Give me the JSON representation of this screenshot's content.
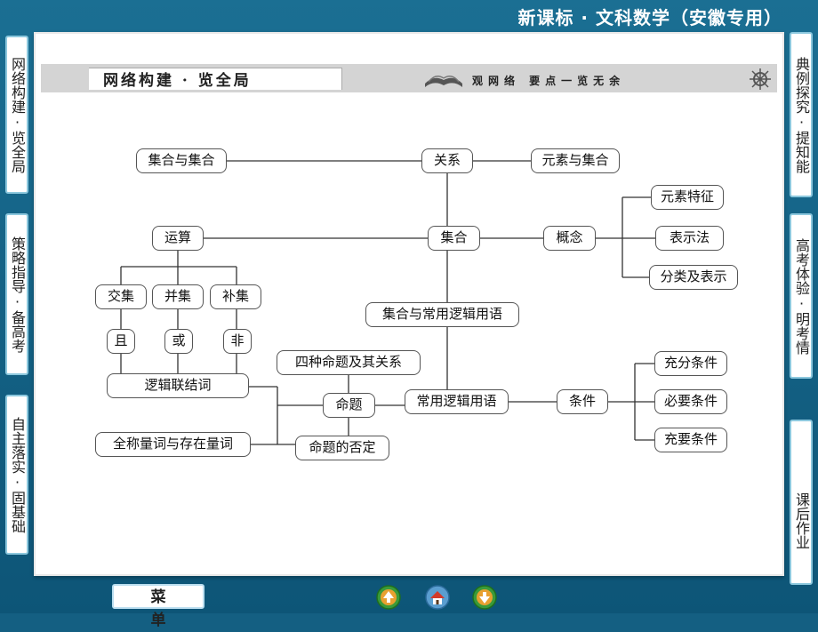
{
  "header": {
    "title": "新课标 · 文科数学（安徽专用）"
  },
  "left_nav": [
    {
      "label": "网络构建·览全局"
    },
    {
      "label": "策略指导·备高考"
    },
    {
      "label": "自主落实·固基础"
    }
  ],
  "right_nav": [
    {
      "label": "典例探究·提知能"
    },
    {
      "label": "高考体验·明考情"
    },
    {
      "label": "课后作业"
    }
  ],
  "banner": {
    "title": "网络构建 · 览全局",
    "subtitle": "观网络  要点一览无余"
  },
  "diagram": {
    "nodes": {
      "guanxi": "关系",
      "jihe_yu_jihe": "集合与集合",
      "yuansu_yu_jihe": "元素与集合",
      "jihe": "集合",
      "yunsuan": "运算",
      "gainian": "概念",
      "yuansu_tezheng": "元素特征",
      "biaoshifa": "表示法",
      "fenlei": "分类及表示",
      "jiaoji": "交集",
      "bingji": "并集",
      "buji": "补集",
      "qie": "且",
      "huo": "或",
      "fei": "非",
      "luoji_lianjieci": "逻辑联结词",
      "jihe_changyong": "集合与常用逻辑用语",
      "sizhong_mingti": "四种命题及其关系",
      "mingti": "命题",
      "changyong_luoji": "常用逻辑用语",
      "tiaojian": "条件",
      "chongfen": "充分条件",
      "biyao": "必要条件",
      "chongyao": "充要条件",
      "quancheng": "全称量词与存在量词",
      "mingti_fouding": "命题的否定"
    }
  },
  "bottom": {
    "menu_label": "菜单"
  }
}
